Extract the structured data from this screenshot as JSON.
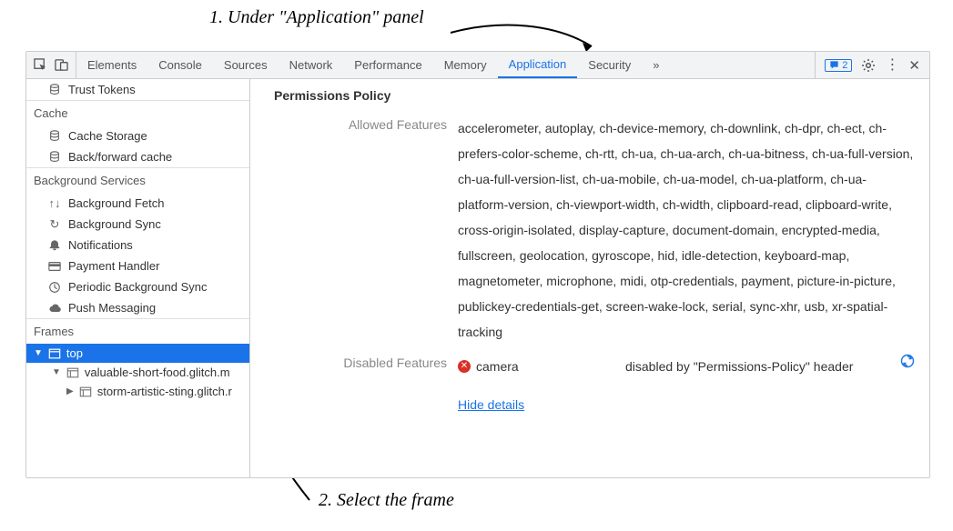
{
  "annotations": {
    "step1": "1. Under \"Application\" panel",
    "step2": "2. Select the frame"
  },
  "tabs": {
    "items": [
      "Elements",
      "Console",
      "Sources",
      "Network",
      "Performance",
      "Memory",
      "Application",
      "Security"
    ],
    "active": "Application",
    "badge_count": "2"
  },
  "sidebar": {
    "trust_tokens": "Trust Tokens",
    "cache": {
      "title": "Cache",
      "items": [
        "Cache Storage",
        "Back/forward cache"
      ]
    },
    "bgservices": {
      "title": "Background Services",
      "items": [
        "Background Fetch",
        "Background Sync",
        "Notifications",
        "Payment Handler",
        "Periodic Background Sync",
        "Push Messaging"
      ]
    },
    "frames": {
      "title": "Frames",
      "top": "top",
      "child1": "valuable-short-food.glitch.m",
      "child2": "storm-artistic-sting.glitch.r"
    }
  },
  "main": {
    "heading": "Permissions Policy",
    "allowed_label": "Allowed Features",
    "allowed_value": "accelerometer, autoplay, ch-device-memory, ch-downlink, ch-dpr, ch-ect, ch-prefers-color-scheme, ch-rtt, ch-ua, ch-ua-arch, ch-ua-bitness, ch-ua-full-version, ch-ua-full-version-list, ch-ua-mobile, ch-ua-model, ch-ua-platform, ch-ua-platform-version, ch-viewport-width, ch-width, clipboard-read, clipboard-write, cross-origin-isolated, display-capture, document-domain, encrypted-media, fullscreen, geolocation, gyroscope, hid, idle-detection, keyboard-map, magnetometer, microphone, midi, otp-credentials, payment, picture-in-picture, publickey-credentials-get, screen-wake-lock, serial, sync-xhr, usb, xr-spatial-tracking",
    "disabled_label": "Disabled Features",
    "disabled_item": "camera",
    "disabled_reason": "disabled by \"Permissions-Policy\" header",
    "hide_details": "Hide details"
  }
}
